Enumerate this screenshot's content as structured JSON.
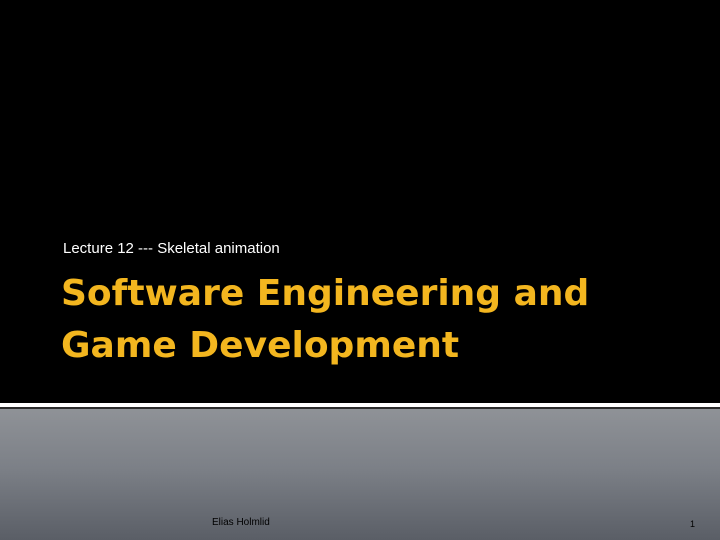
{
  "slide": {
    "subtitle": "Lecture 12 --- Skeletal animation",
    "title_lines": [
      "Software Engineering and",
      "Game Development"
    ],
    "footer": {
      "author": "Elias Holmlid",
      "slide_number": "1"
    }
  },
  "colors": {
    "background": "#000000",
    "title": "#f3b61f",
    "subtitle": "#ffffff",
    "divider": "#ffffff",
    "footer_gradient_top": "#8f9297",
    "footer_gradient_bottom": "#5a5e66"
  }
}
